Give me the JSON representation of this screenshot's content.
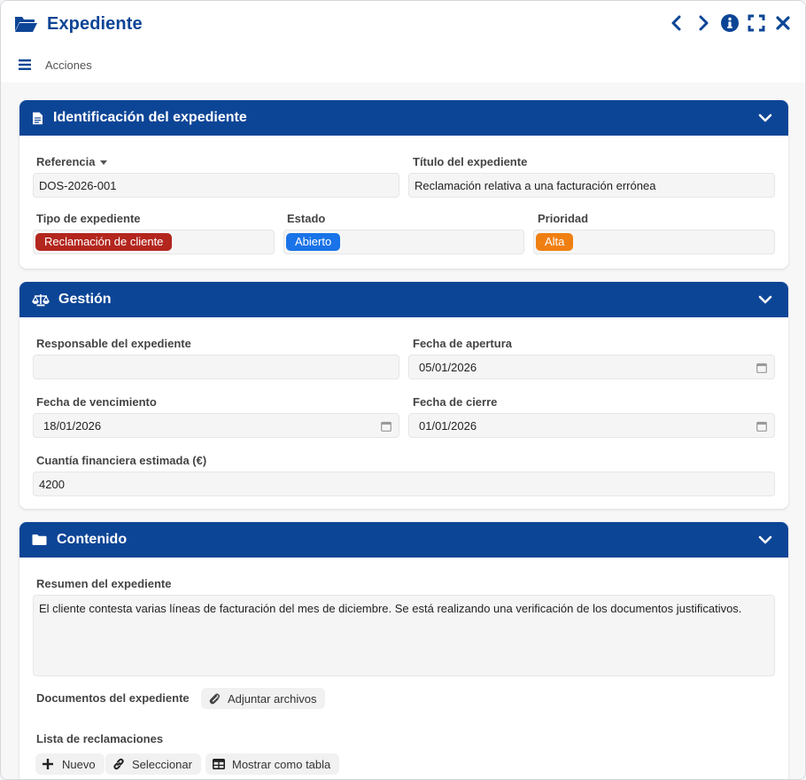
{
  "window": {
    "title": "Expediente",
    "actions_label": "Acciones"
  },
  "colors": {
    "primary": "#0d4596",
    "badge_type": "#b3261e",
    "badge_state": "#1a73e8",
    "badge_priority": "#f07f12"
  },
  "sections": {
    "identification": {
      "title": "Identificación del expediente",
      "reference_label": "Referencia",
      "reference_value": "DOS-2026-001",
      "file_title_label": "Título del expediente",
      "file_title_value": "Reclamación relativa a una facturación errónea",
      "type_label": "Tipo de expediente",
      "type_value": "Reclamación de cliente",
      "state_label": "Estado",
      "state_value": "Abierto",
      "priority_label": "Prioridad",
      "priority_value": "Alta"
    },
    "management": {
      "title": "Gestión",
      "responsible_label": "Responsable del expediente",
      "responsible_value": "",
      "opening_label": "Fecha de apertura",
      "opening_value": "05/01/2026",
      "due_label": "Fecha de vencimiento",
      "due_value": "18/01/2026",
      "closing_label": "Fecha de cierre",
      "closing_value": "01/01/2026",
      "amount_label": "Cuantía financiera estimada (€)",
      "amount_value": "4200"
    },
    "content": {
      "title": "Contenido",
      "summary_label": "Resumen del expediente",
      "summary_value": "El cliente contesta varias líneas de facturación del mes de diciembre. Se está realizando una verificación de los documentos justificativos.",
      "documents_label": "Documentos del expediente",
      "attach_label": "Adjuntar archivos",
      "claims_label": "Lista de reclamaciones",
      "new_label": "Nuevo",
      "select_label": "Seleccionar",
      "show_table_label": "Mostrar como tabla"
    }
  }
}
